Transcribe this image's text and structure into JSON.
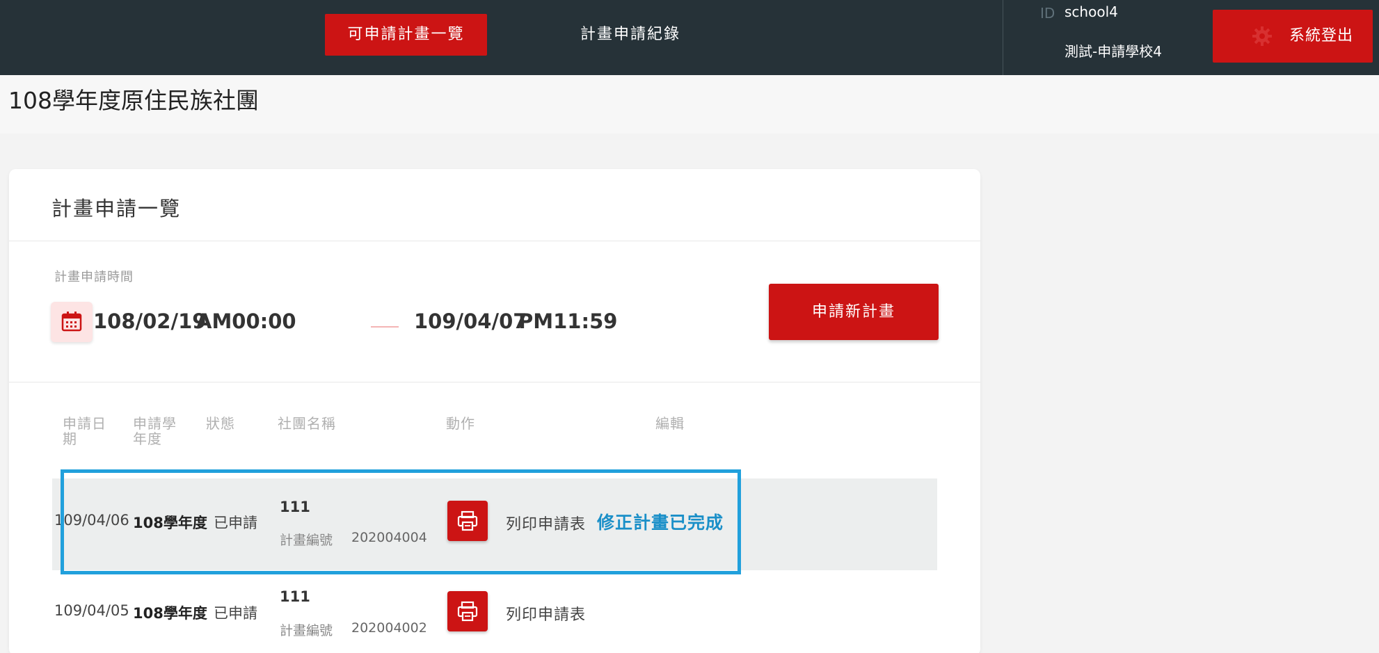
{
  "nav": {
    "available_plans": "可申請計畫一覽",
    "plan_records": "計畫申請紀錄"
  },
  "user": {
    "id_tag": "ID",
    "id": "school4",
    "school": "測試-申請學校4"
  },
  "logout": {
    "label": "系統登出",
    "icon": "gear-icon"
  },
  "page": {
    "title": "108學年度原住民族社團"
  },
  "card": {
    "title": "計畫申請一覽",
    "period_label": "計畫申請時間",
    "start_date": "108/02/19",
    "start_time": "AM00:00",
    "end_date": "109/04/07",
    "end_time": "PM11:59",
    "apply_button": "申請新計畫"
  },
  "table": {
    "headers": {
      "date": "申請日期",
      "year": "申請學年度",
      "status": "狀態",
      "club": "社團名稱",
      "action": "動作",
      "edit": "編輯"
    },
    "plan_no_label": "計畫編號",
    "rows": [
      {
        "date": "109/04/06",
        "year": "108學年度",
        "status": "已申請",
        "club": "111",
        "plan_no": "202004004",
        "print_label": "列印申請表",
        "edit": "修正計畫已完成"
      },
      {
        "date": "109/04/05",
        "year": "108學年度",
        "status": "已申請",
        "club": "111",
        "plan_no": "202004002",
        "print_label": "列印申請表",
        "edit": ""
      }
    ]
  },
  "colors": {
    "accent": "#cc1414",
    "topbar": "#263238",
    "highlight": "#21a0dc",
    "edit_link": "#1a8fc8"
  }
}
